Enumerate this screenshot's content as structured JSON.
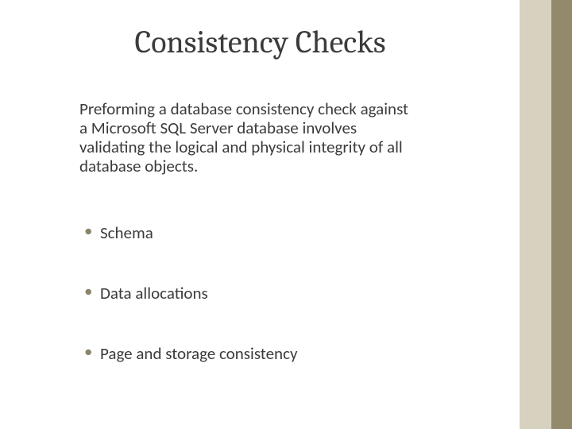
{
  "slide": {
    "title": "Consistency Checks",
    "paragraph": "Preforming a database consistency check against a Microsoft SQL Server database involves validating the logical and physical integrity of all database objects.",
    "bullets": [
      "Schema",
      "Data allocations",
      "Page and storage consistency"
    ]
  }
}
